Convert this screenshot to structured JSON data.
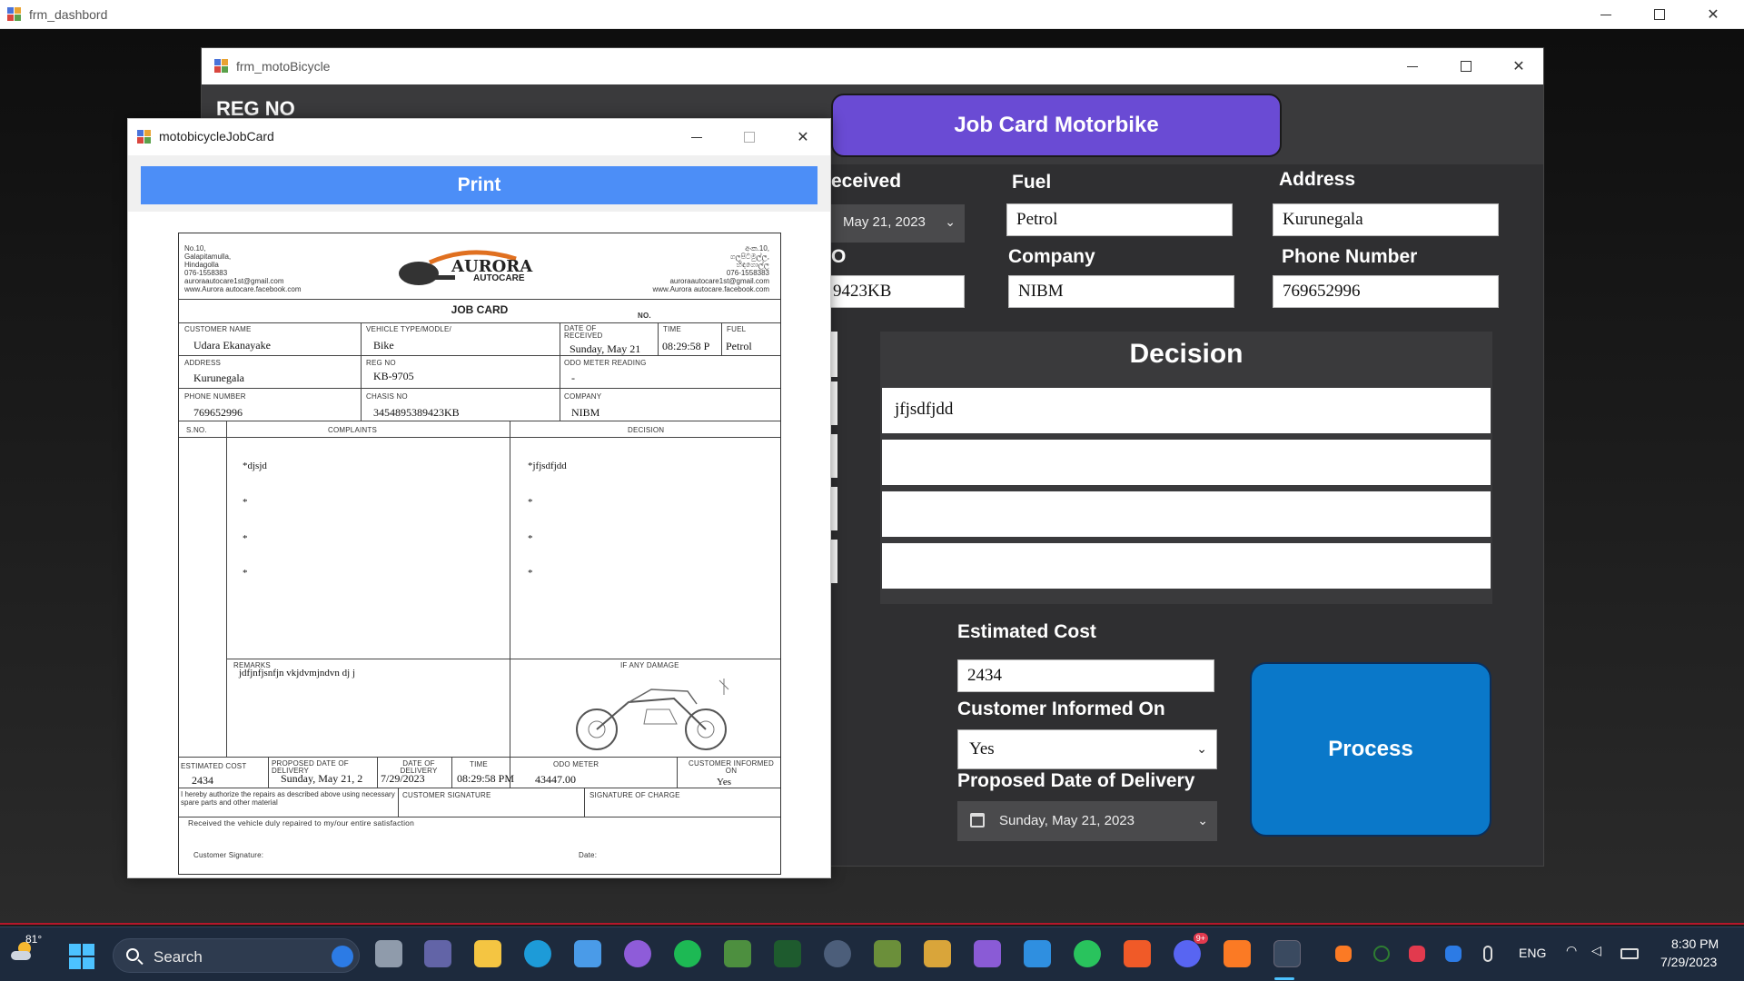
{
  "dashboard": {
    "title": "frm_dashbord"
  },
  "moto_window": {
    "title": "frm_motoBicycle",
    "reg_no_label": "REG NO",
    "header_title": "Job Card Motorbike",
    "date_received_label": "eceived",
    "date_received_value": "May 21, 2023",
    "fuel_label": "Fuel",
    "fuel_value": "Petrol",
    "address_label": "Address",
    "address_value": "Kurunegala",
    "chassis_label_partial": "O",
    "chassis_value_partial": "9423KB",
    "company_label": "Company",
    "company_value": "NIBM",
    "phone_label": "Phone Number",
    "phone_value": "769652996",
    "decision_title": "Decision",
    "decision_rows": [
      "jfjsdfjdd",
      "",
      "",
      ""
    ],
    "estimated_cost_label": "Estimated Cost",
    "estimated_cost_value": "2434",
    "customer_informed_label": "Customer Informed On",
    "customer_informed_value": "Yes",
    "proposed_delivery_label": "Proposed Date of Delivery",
    "proposed_delivery_value": "Sunday,  May 21, 2023",
    "process_button": "Process"
  },
  "jobcard_window": {
    "title": "motobicycleJobCard",
    "print_button": "Print",
    "form": {
      "left_address": "No.10,\nGalapitamulla,\nHindagolla\n076-1558383\nauroraautocare1st@gmail.com\nwww.Aurora autocare.facebook.com",
      "right_address": "අංක.10,\nගලපිටමුල්ල,\nහිඳගොල්ල\n076-1558383\nauroraautocare1st@gmail.com\nwww.Aurora autocare.facebook.com",
      "logo_text_1": "AURORA",
      "logo_text_2": "AUTOCARE",
      "heading": "JOB CARD",
      "no_label": "NO.",
      "customer_name_label": "CUSTOMER NAME",
      "customer_name": "Udara Ekanayake",
      "vehicle_type_label": "VEHICLE TYPE/MODLE/",
      "vehicle_type": "Bike",
      "date_received_label": "DATE OF RECEIVED",
      "date_received": "Sunday, May 21",
      "time_label": "TIME",
      "time": "08:29:58 P",
      "fuel_label": "FUEL",
      "fuel": "Petrol",
      "address_label": "ADDRESS",
      "address": "Kurunegala",
      "reg_no_label": "REG NO",
      "reg_no": "KB-9705",
      "odo_label": "ODO METER READING",
      "odo": "-",
      "phone_label": "PHONE NUMBER",
      "phone": "769652996",
      "chassis_label": "CHASIS NO",
      "chassis": "3454895389423KB",
      "company_label": "COMPANY",
      "company": "NIBM",
      "sno_label": "S.NO.",
      "complaints_label": "COMPLAINTS",
      "decision_label": "DECISION",
      "complaints": [
        "*djsjd",
        "*",
        "*",
        "*"
      ],
      "decisions": [
        "*jfjsdfjdd",
        "*",
        "*",
        "*"
      ],
      "remarks_label": "REMARKS",
      "remarks": "jdfjnfjsnfjn vkjdvmjndvn dj j",
      "damage_label": "IF ANY DAMAGE",
      "est_cost_label": "ESTIMATED COST",
      "est_cost": "2434",
      "proposed_label": "PROPOSED DATE OF DELIVERY",
      "proposed": "Sunday, May 21, 2",
      "delivery_label": "DATE OF DELIVERY",
      "delivery": "7/29/2023",
      "time2_label": "TIME",
      "time2": "08:29:58 PM",
      "odo2_label": "ODO METER",
      "odo2": "43447.00",
      "informed_label": "CUSTOMER INFORMED ON",
      "informed": "Yes",
      "authorize_text": "I hereby authorize the repairs as described above using necessary spare parts and other material",
      "cust_sig_label": "CUSTOMER SIGNATURE",
      "charge_sig_label": "SIGNATURE OF CHARGE",
      "received_text": "Received the vehicle duly repaired to my/our  entire satisfaction",
      "customer_signature_label": "Customer Signature:",
      "date_label": "Date:"
    }
  },
  "taskbar": {
    "weather": "81°",
    "search_placeholder": "Search",
    "lang": "ENG",
    "time": "8:30 PM",
    "date": "7/29/2023",
    "discord_badge": "9+",
    "icons": [
      "task-view-icon",
      "teams-icon",
      "file-explorer-icon",
      "edge-icon",
      "store-icon",
      "github-icon",
      "spotify-icon",
      "app-icon",
      "terminal-icon",
      "obs-icon",
      "minecraft-icon",
      "tool-icon",
      "visual-studio-icon",
      "vscode-icon",
      "whatsapp-icon",
      "brave-icon",
      "discord-icon",
      "xampp-icon",
      "winforms-app-icon"
    ]
  }
}
